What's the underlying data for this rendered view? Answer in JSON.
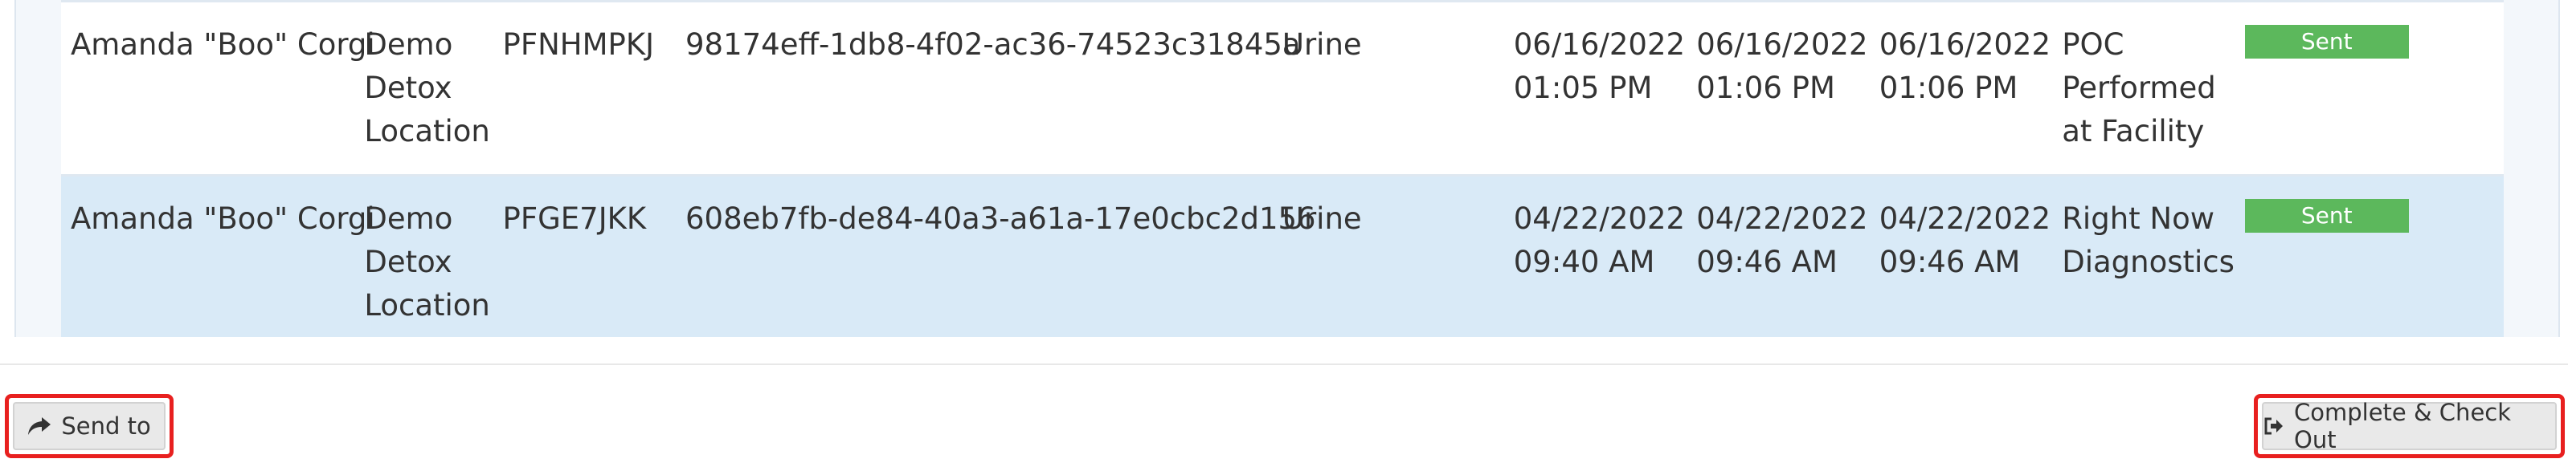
{
  "rows": [
    {
      "name": "Amanda \"Boo\" Corgi",
      "location": [
        "Demo",
        "Detox",
        "Location"
      ],
      "code": "PFNHMPKJ",
      "id": "98174eff-1db8-4f02-ac36-74523c31845a",
      "specimen": "Urine",
      "date1": [
        "06/16/2022",
        "01:05 PM"
      ],
      "date2": [
        "06/16/2022",
        "01:06 PM"
      ],
      "date3": [
        "06/16/2022",
        "01:06 PM"
      ],
      "lab": [
        "POC",
        "Performed",
        "at Facility"
      ],
      "status": "Sent"
    },
    {
      "name": "Amanda \"Boo\" Corgi",
      "location": [
        "Demo",
        "Detox",
        "Location"
      ],
      "code": "PFGE7JKK",
      "id": "608eb7fb-de84-40a3-a61a-17e0cbc2d156",
      "specimen": "Urine",
      "date1": [
        "04/22/2022",
        "09:40 AM"
      ],
      "date2": [
        "04/22/2022",
        "09:46 AM"
      ],
      "date3": [
        "04/22/2022",
        "09:46 AM"
      ],
      "lab": [
        "Right Now",
        "Diagnostics"
      ],
      "status": "Sent"
    }
  ],
  "footer": {
    "send_label": "Send to",
    "complete_label": "Complete & Check Out",
    "send_icon": "share-arrow-icon",
    "complete_icon": "sign-out-icon"
  },
  "colors": {
    "status_sent": "#5cb85c",
    "highlight_border": "#e8201f",
    "row_alt": "#d9eaf7"
  }
}
